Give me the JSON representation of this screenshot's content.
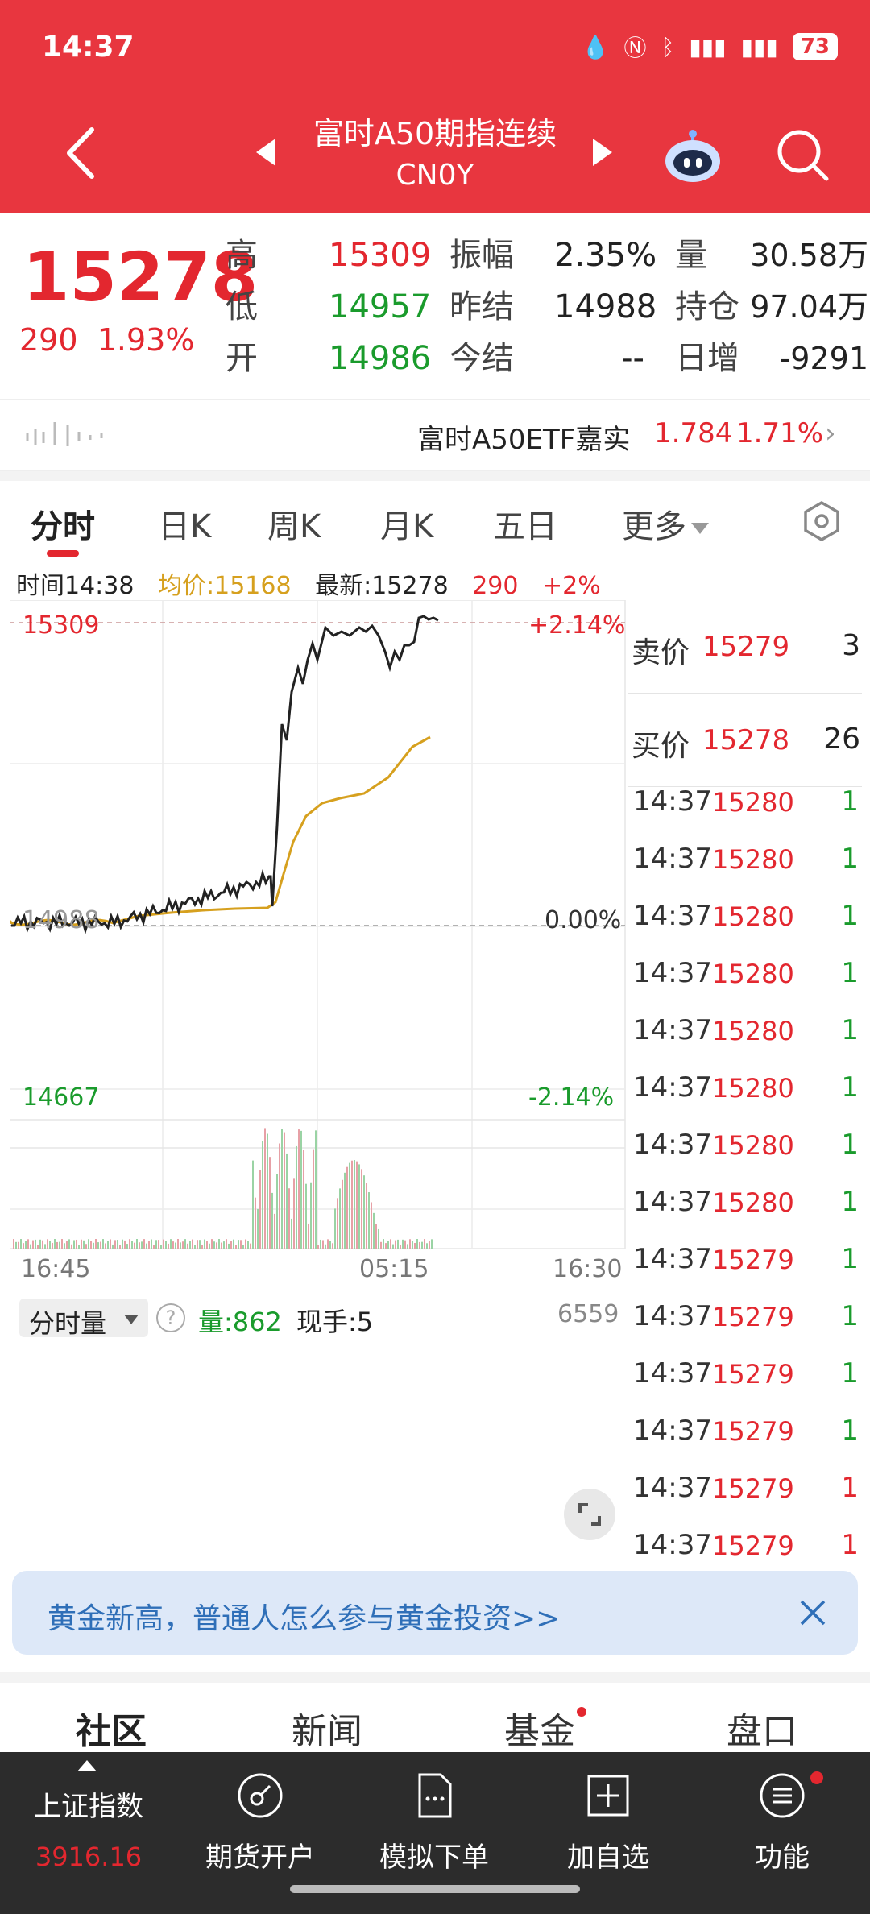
{
  "status_bar": {
    "time": "14:37",
    "battery": "73"
  },
  "nav": {
    "title": "富时A50期指连续",
    "subtitle": "CN0Y"
  },
  "quote": {
    "price": "15278",
    "change": "290",
    "change_pct": "1.93%",
    "rows": [
      [
        {
          "label": "高",
          "value": "15309",
          "color": "red"
        },
        {
          "label": "振幅",
          "value": "2.35%",
          "color": "dark"
        },
        {
          "label": "量",
          "value": "30.58万",
          "color": "dark"
        }
      ],
      [
        {
          "label": "低",
          "value": "14957",
          "color": "green"
        },
        {
          "label": "昨结",
          "value": "14988",
          "color": "dark"
        },
        {
          "label": "持仓",
          "value": "97.04万",
          "color": "dark"
        }
      ],
      [
        {
          "label": "开",
          "value": "14986",
          "color": "green"
        },
        {
          "label": "今结",
          "value": "--",
          "color": "dark"
        },
        {
          "label": "日增",
          "value": "-9291",
          "color": "dark"
        }
      ]
    ]
  },
  "etf": {
    "name": "富时A50ETF嘉实",
    "price": "1.784",
    "pct": "1.71%"
  },
  "tabs": {
    "items": [
      "分时",
      "日K",
      "周K",
      "月K",
      "五日",
      "更多"
    ],
    "active": 0
  },
  "info": {
    "time": "时间14:38",
    "avg": "均价:15168",
    "latest": "最新:15278",
    "chg": "290",
    "pct": "+2%"
  },
  "chart_labels": {
    "high": "15309",
    "high_pct": "+2.14%",
    "mid": "14988",
    "mid_pct": "0.00%",
    "low": "14667",
    "low_pct": "-2.14%",
    "x_start": "16:45",
    "x_mid": "05:15",
    "x_end": "16:30"
  },
  "volume_panel": {
    "selector": "分时量",
    "help": "?",
    "volume": "量:862",
    "current": "现手:5",
    "max": "6559"
  },
  "order_book": [
    {
      "label": "卖价",
      "price": "15279",
      "qty": "3"
    },
    {
      "label": "买价",
      "price": "15278",
      "qty": "26"
    }
  ],
  "ticks": [
    {
      "time": "14:37",
      "price": "15280",
      "qty": "1",
      "dir": "green"
    },
    {
      "time": "14:37",
      "price": "15280",
      "qty": "1",
      "dir": "green"
    },
    {
      "time": "14:37",
      "price": "15280",
      "qty": "1",
      "dir": "green"
    },
    {
      "time": "14:37",
      "price": "15280",
      "qty": "1",
      "dir": "green"
    },
    {
      "time": "14:37",
      "price": "15280",
      "qty": "1",
      "dir": "green"
    },
    {
      "time": "14:37",
      "price": "15280",
      "qty": "1",
      "dir": "green"
    },
    {
      "time": "14:37",
      "price": "15280",
      "qty": "1",
      "dir": "green"
    },
    {
      "time": "14:37",
      "price": "15280",
      "qty": "1",
      "dir": "green"
    },
    {
      "time": "14:37",
      "price": "15279",
      "qty": "1",
      "dir": "green"
    },
    {
      "time": "14:37",
      "price": "15279",
      "qty": "1",
      "dir": "green"
    },
    {
      "time": "14:37",
      "price": "15279",
      "qty": "1",
      "dir": "green"
    },
    {
      "time": "14:37",
      "price": "15279",
      "qty": "1",
      "dir": "green"
    },
    {
      "time": "14:37",
      "price": "15279",
      "qty": "1",
      "dir": "red"
    },
    {
      "time": "14:37",
      "price": "15279",
      "qty": "1",
      "dir": "red"
    }
  ],
  "banner": {
    "text": "黄金新高，普通人怎么参与黄金投资>>"
  },
  "categories": [
    "社区",
    "新闻",
    "基金",
    "盘口"
  ],
  "bottom_bar": {
    "index_name": "上证指数",
    "index_value": "3916.16",
    "items": [
      "期货开户",
      "模拟下单",
      "加自选",
      "功能"
    ]
  },
  "colors": {
    "brand": "#e8363f",
    "up": "#e3272f",
    "down": "#1a9b2c",
    "avg_line": "#d6a01e"
  }
}
